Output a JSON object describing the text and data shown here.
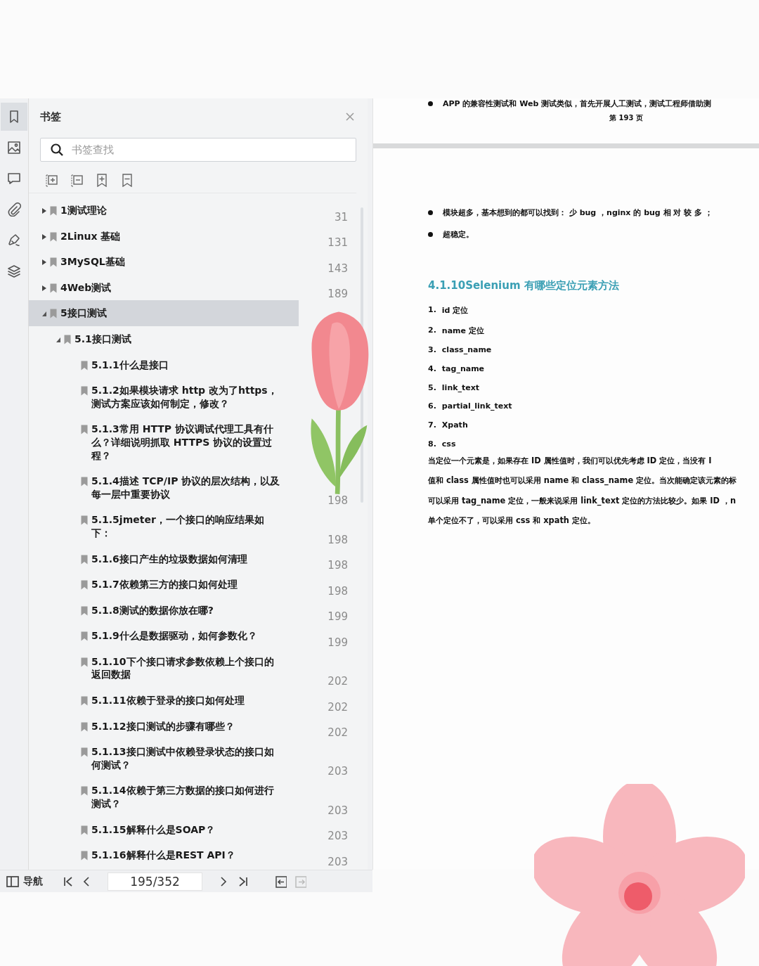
{
  "rail": [
    {
      "selected": true
    },
    {
      "selected": false
    },
    {
      "selected": false
    },
    {
      "selected": false
    },
    {
      "selected": false
    },
    {
      "selected": false
    }
  ],
  "bookmarks": {
    "title": "书签",
    "search": {
      "placeholder": "书签查找"
    },
    "items": [
      {
        "title": "1测试理论",
        "page": "31",
        "expanded": false,
        "selected": false
      },
      {
        "title": "2Linux 基础",
        "page": "131",
        "expanded": false,
        "selected": false
      },
      {
        "title": "3MySQL基础",
        "page": "143",
        "expanded": false,
        "selected": false
      },
      {
        "title": "4Web测试",
        "page": "189",
        "expanded": false,
        "selected": false
      },
      {
        "title": "5接口测试",
        "expanded": true,
        "selected": true,
        "children": [
          {
            "title": "5.1接口测试",
            "expanded": true,
            "selected": false,
            "children": [
              {
                "title": "5.1.1什么是接口",
                "selected": false
              },
              {
                "title": "5.1.2如果模块请求 http 改为了https，测试方案应该如何制定，修改？",
                "selected": false
              },
              {
                "title": "5.1.3常用 HTTP 协议调试代理工具有什么？详细说明抓取 HTTPS 协议的设置过程？",
                "selected": false
              },
              {
                "title": "5.1.4描述 TCP/IP 协议的层次结构，以及每一层中重要协议",
                "page": "198",
                "selected": false
              },
              {
                "title": "5.1.5jmeter，一个接口的响应结果如下：",
                "page": "198",
                "selected": false
              },
              {
                "title": "5.1.6接口产生的垃圾数据如何清理",
                "page": "198",
                "selected": false
              },
              {
                "title": "5.1.7依赖第三方的接口如何处理",
                "page": "198",
                "selected": false
              },
              {
                "title": "5.1.8测试的数据你放在哪?",
                "page": "199",
                "selected": false
              },
              {
                "title": "5.1.9什么是数据驱动，如何参数化？",
                "page": "199",
                "selected": false
              },
              {
                "title": "5.1.10下个接口请求参数依赖上个接口的返回数据",
                "page": "202",
                "selected": false
              },
              {
                "title": "5.1.11依赖于登录的接口如何处理",
                "page": "202",
                "selected": false
              },
              {
                "title": "5.1.12接口测试的步骤有哪些？",
                "page": "202",
                "selected": false
              },
              {
                "title": "5.1.13接口测试中依赖登录状态的接口如何测试？",
                "page": "203",
                "selected": false
              },
              {
                "title": "5.1.14依赖于第三方数据的接口如何进行测试？",
                "page": "203",
                "selected": false
              },
              {
                "title": "5.1.15解释什么是SOAP？",
                "page": "203",
                "selected": false
              },
              {
                "title": "5.1.16解释什么是REST API？",
                "page": "203",
                "selected": false
              }
            ]
          }
        ]
      }
    ]
  },
  "navigation": {
    "toggle_label": "导航",
    "page_field": "195/352",
    "back_enabled": true,
    "forward_enabled": false
  },
  "document": {
    "previous_page": {
      "bullet": "APP 的兼容性测试和 Web 测试类似，首先开展人工测试，测试工程师借助测",
      "footer": "第 193 页"
    },
    "page": {
      "bullets": [
        "模块超多，基本想到的都可以找到： 少 bug ，nginx 的 bug 相 对 较 多 ；",
        "超稳定。"
      ],
      "heading": "4.1.10Selenium 有哪些定位元素方法",
      "list": [
        {
          "number": "1.",
          "text": "id 定位"
        },
        {
          "number": "2.",
          "text": "name 定位"
        },
        {
          "number": "3.",
          "text": "class_name"
        },
        {
          "number": "4.",
          "text": "tag_name"
        },
        {
          "number": "5.",
          "text": "link_text"
        },
        {
          "number": "6.",
          "text": "partial_link_text"
        },
        {
          "number": "7.",
          "text": "Xpath"
        },
        {
          "number": "8.",
          "text": "css"
        }
      ],
      "paragraph_lines": [
        "当定位一个元素是，如果存在 ID 属性值时，我们可以优先考虑 ID 定位，当没有 I",
        "值和 class 属性值时也可以采用 name 和 class_name 定位。当次能确定该元素的标",
        "可以采用 tag_name 定位，一般来说采用 link_text 定位的方法比较少。如果 ID ，n",
        "单个定位不了，可以采用 css 和 xpath 定位。"
      ]
    }
  }
}
